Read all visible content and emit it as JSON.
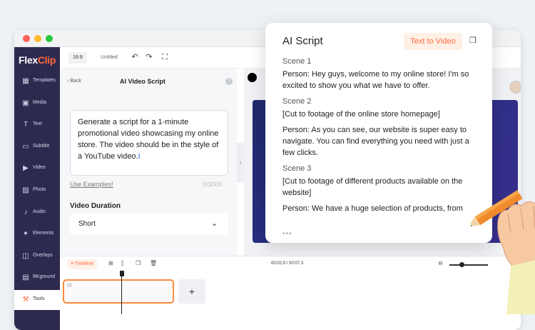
{
  "app": {
    "logo_main": "Flex",
    "logo_accent": "Clip"
  },
  "sidebar": {
    "items": [
      {
        "label": "Templates",
        "icon": "templates-icon"
      },
      {
        "label": "Media",
        "icon": "media-icon"
      },
      {
        "label": "Text",
        "icon": "text-icon"
      },
      {
        "label": "Subtitle",
        "icon": "subtitle-icon"
      },
      {
        "label": "Video",
        "icon": "video-icon"
      },
      {
        "label": "Photo",
        "icon": "photo-icon"
      },
      {
        "label": "Audio",
        "icon": "audio-icon"
      },
      {
        "label": "Elements",
        "icon": "elements-icon"
      },
      {
        "label": "Overlays",
        "icon": "overlays-icon"
      },
      {
        "label": "BKground",
        "icon": "background-icon"
      },
      {
        "label": "Tools",
        "icon": "tools-icon",
        "active": true
      }
    ]
  },
  "toolbar": {
    "ratio": "16:9",
    "title": "Untitled"
  },
  "panel": {
    "back": "Back",
    "title": "AI Video Script",
    "prompt": "Generate a script for a 1-minute promotional video showcasing my online store. The video should be in the style of a YouTube video.",
    "examples": "Use Examples!",
    "counter": "0/3000",
    "duration_label": "Video Duration",
    "duration_value": "Short"
  },
  "timeline": {
    "label": "Timeline",
    "time": "00:02.9 / 00:07.3"
  },
  "card": {
    "title": "AI Script",
    "button": "Text to Video",
    "scenes": [
      {
        "heading": "Scene 1",
        "lines": [
          "Person: Hey guys, welcome to my online store! I'm so excited to show you what we have to offer."
        ]
      },
      {
        "heading": "Scene 2",
        "lines": [
          "[Cut to footage of the online store homepage]",
          "Person: As you can see, our website is super easy to navigate. You can find everything you need with just a few clicks."
        ]
      },
      {
        "heading": "Scene 3",
        "lines": [
          "[Cut to footage of different products available on the website]",
          "Person: We have a huge selection of products, from"
        ]
      }
    ],
    "more": "•••"
  },
  "colors": {
    "accent": "#ff6a3d",
    "sidebar": "#2d2a4f",
    "traffic": [
      "#ff5f57",
      "#febc2e",
      "#28c840"
    ]
  }
}
